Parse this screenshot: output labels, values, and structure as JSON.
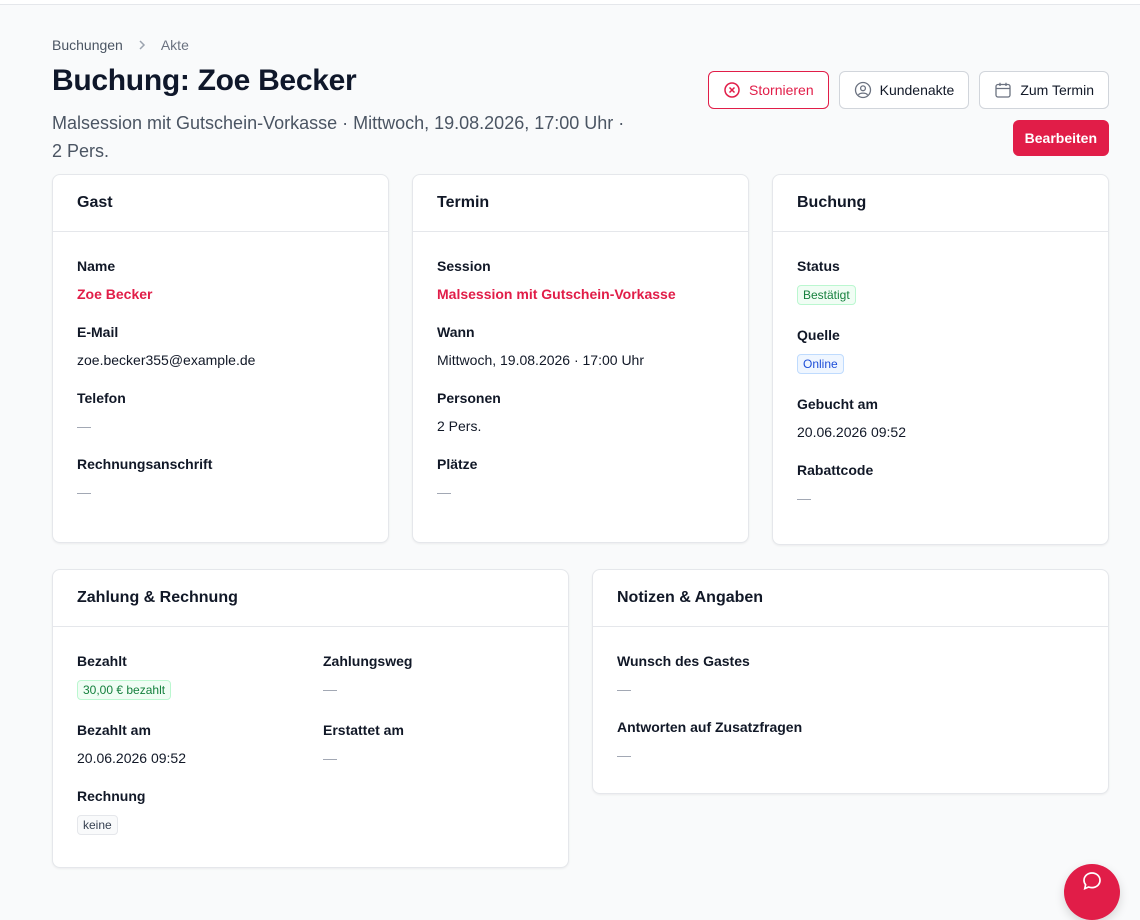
{
  "breadcrumb": {
    "root": "Buchungen",
    "current": "Akte"
  },
  "header": {
    "title": "Buchung: Zoe Becker",
    "subtitle": "Malsession mit Gutschein-Vorkasse · Mittwoch, 19.08.2026, 17:00 Uhr · 2 Pers."
  },
  "actions": {
    "cancel_label": "Stornieren",
    "customer_label": "Kundenakte",
    "appointment_label": "Zum Termin",
    "edit_label": "Bearbeiten"
  },
  "guest": {
    "title": "Gast",
    "name_label": "Name",
    "name_value": "Zoe Becker",
    "email_label": "E-Mail",
    "email_value": "zoe.becker355@example.de",
    "phone_label": "Telefon",
    "phone_value": "—",
    "address_label": "Rechnungsanschrift",
    "address_value": "—"
  },
  "appointment": {
    "title": "Termin",
    "session_label": "Session",
    "session_value": "Malsession mit Gutschein-Vorkasse",
    "when_label": "Wann",
    "when_value": "Mittwoch, 19.08.2026 · 17:00 Uhr",
    "persons_label": "Personen",
    "persons_value": "2 Pers.",
    "seats_label": "Plätze",
    "seats_value": "—"
  },
  "booking": {
    "title": "Buchung",
    "status_label": "Status",
    "status_value": "Bestätigt",
    "source_label": "Quelle",
    "source_value": "Online",
    "booked_label": "Gebucht am",
    "booked_value": "20.06.2026 09:52",
    "discount_label": "Rabattcode",
    "discount_value": "—"
  },
  "payment": {
    "title": "Zahlung & Rechnung",
    "paid_label": "Bezahlt",
    "paid_value": "30,00 € bezahlt",
    "method_label": "Zahlungsweg",
    "method_value": "—",
    "paid_at_label": "Bezahlt am",
    "paid_at_value": "20.06.2026 09:52",
    "refunded_label": "Erstattet am",
    "refunded_value": "—",
    "invoice_label": "Rechnung",
    "invoice_value": "keine"
  },
  "notes": {
    "title": "Notizen & Angaben",
    "wish_label": "Wunsch des Gastes",
    "wish_value": "—",
    "answers_label": "Antworten auf Zusatzfragen",
    "answers_value": "—"
  },
  "colors": {
    "accent": "#e11d48",
    "success": "#15803d",
    "info": "#1d4ed8"
  }
}
